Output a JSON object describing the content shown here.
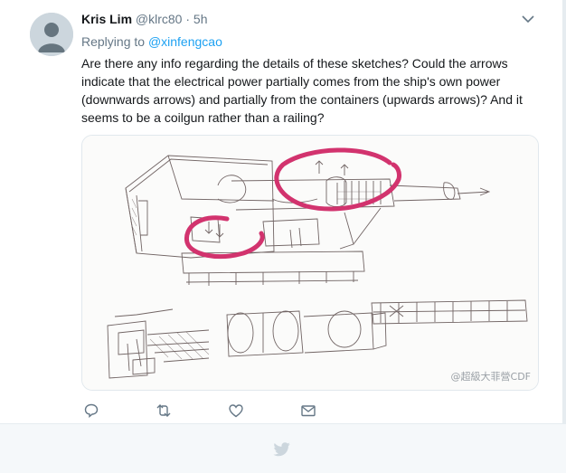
{
  "tweet": {
    "author_name": "Kris Lim",
    "author_handle": "@klrc80",
    "separator": "·",
    "time": "5h",
    "replying_prefix": "Replying to",
    "replying_mention": "@xinfengcao",
    "text": "Are there any info regarding the details of these sketches? Could the arrows indicate that the electrical power partially comes from the ship's own power (downwards arrows) and partially from the containers (upwards arrows)? And it seems to be a coilgun rather than a railing?",
    "media_watermark": "@超級大菲營CDF"
  },
  "icons": {
    "avatar": "default-avatar-silhouette",
    "menu": "chevron-down-icon",
    "reply": "reply-icon",
    "retweet": "retweet-icon",
    "like": "heart-icon",
    "dm": "envelope-icon",
    "brand": "twitter-bird-icon"
  },
  "colors": {
    "link": "#1da1f2",
    "muted_text": "#657786",
    "highlight_circle": "#d2336e",
    "footer_bg": "#f5f8fa"
  }
}
